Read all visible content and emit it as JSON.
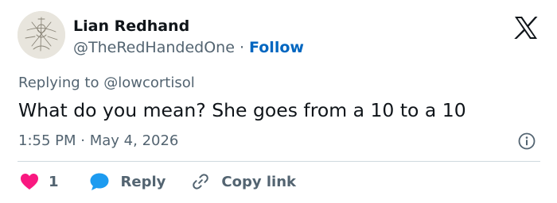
{
  "author": {
    "display_name": "Lian Redhand",
    "handle": "@TheRedHandedOne",
    "separator": "·",
    "follow_label": "Follow"
  },
  "reply_context": {
    "prefix": "Replying to",
    "handle": "@lowcortisol"
  },
  "tweet": {
    "text": "What do you mean? She goes from a 10 to a 10",
    "time": "1:55 PM",
    "separator": "·",
    "date": "May 4, 2026"
  },
  "actions": {
    "like_count": "1",
    "reply_label": "Reply",
    "copy_link_label": "Copy link"
  },
  "icons": {
    "avatar": "sketch-avatar",
    "logo": "x-logo-icon",
    "info": "info-icon",
    "like": "heart-icon",
    "reply": "speech-bubble-icon",
    "copy": "link-icon"
  },
  "colors": {
    "like": "#f91880",
    "reply": "#1d9bf0",
    "follow": "#0066c0",
    "secondary_text": "#536471",
    "primary_text": "#0f1419",
    "divider": "#cfd9de"
  }
}
